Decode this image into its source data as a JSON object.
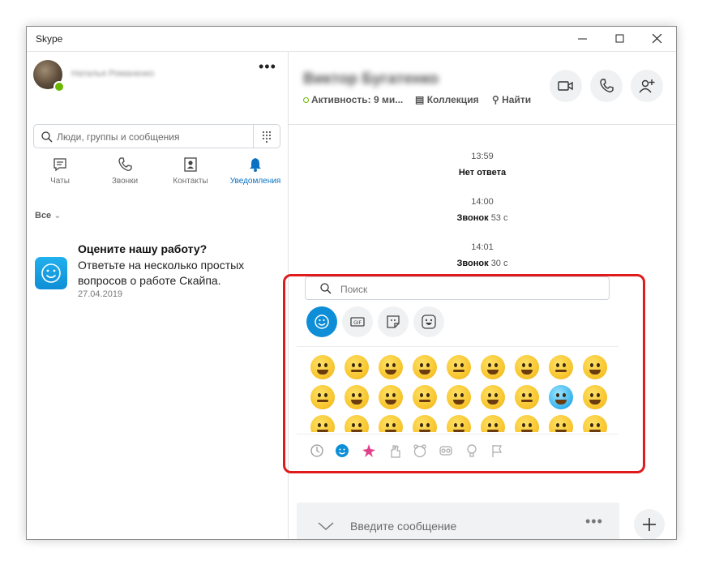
{
  "window": {
    "title": "Skype"
  },
  "profile": {
    "name": "Наталья Романенко"
  },
  "search": {
    "placeholder": "Люди, группы и сообщения"
  },
  "tabs": [
    {
      "label": "Чаты",
      "icon": "chat-icon"
    },
    {
      "label": "Звонки",
      "icon": "phone-icon"
    },
    {
      "label": "Контакты",
      "icon": "contacts-icon"
    },
    {
      "label": "Уведомления",
      "icon": "bell-icon",
      "active": true
    }
  ],
  "filter": {
    "label": "Все"
  },
  "notification": {
    "title": "Оцените нашу работу?",
    "body": "Ответьте на несколько простых вопросов о работе Скайпа.",
    "date": "27.04.2019"
  },
  "chat": {
    "contact_name": "Виктор Бугатенко",
    "activity": "Активность: 9 ми...",
    "collection": "Коллекция",
    "find": "Найти"
  },
  "messages": [
    {
      "time": "13:59",
      "text": "Нет ответа",
      "duration": ""
    },
    {
      "time": "14:00",
      "text": "Звонок",
      "duration": "53 с"
    },
    {
      "time": "14:01",
      "text": "Звонок",
      "duration": "30 с"
    }
  ],
  "emoji_panel": {
    "search_placeholder": "Поиск",
    "categories": [
      "emoji",
      "gif",
      "stickers",
      "moji"
    ],
    "bottom_tabs": [
      "recent",
      "smileys",
      "celebration",
      "hands",
      "animals",
      "objects",
      "ideas",
      "flags"
    ]
  },
  "composer": {
    "placeholder": "Введите сообщение"
  },
  "colors": {
    "accent": "#0e8ed6",
    "presence": "#6bb700",
    "highlight": "#e01b1b"
  }
}
